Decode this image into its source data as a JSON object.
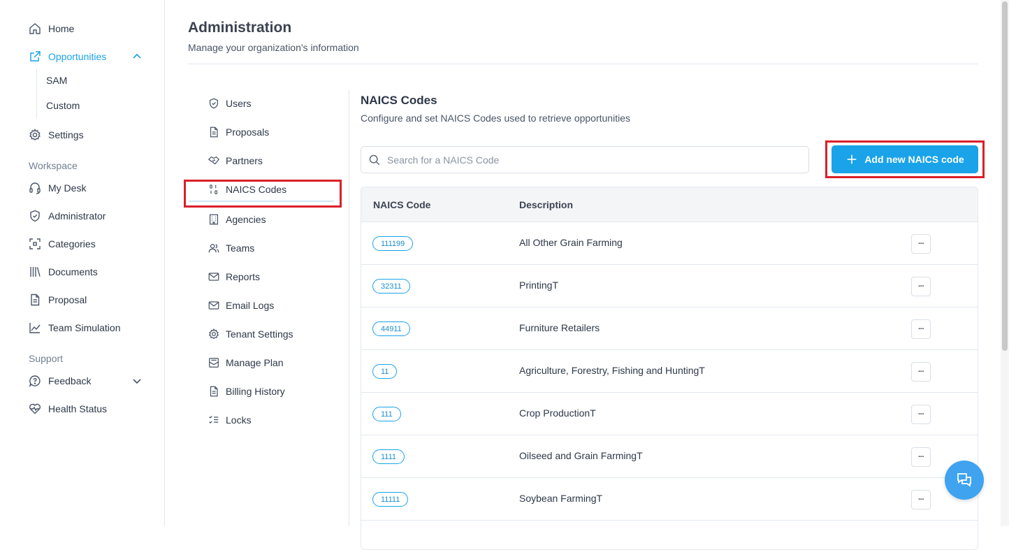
{
  "sidebar": {
    "home": "Home",
    "opportunities": "Opportunities",
    "opp_sub": [
      "SAM",
      "Custom"
    ],
    "settings": "Settings",
    "workspace_heading": "Workspace",
    "workspace": [
      "My Desk",
      "Administrator",
      "Categories",
      "Documents",
      "Proposal",
      "Team Simulation"
    ],
    "support_heading": "Support",
    "feedback": "Feedback",
    "health": "Health Status"
  },
  "header": {
    "title": "Administration",
    "subtitle": "Manage your organization's information"
  },
  "settings_menu": [
    "Users",
    "Proposals",
    "Partners",
    "NAICS Codes",
    "Agencies",
    "Teams",
    "Reports",
    "Email Logs",
    "Tenant Settings",
    "Manage Plan",
    "Billing History",
    "Locks"
  ],
  "content": {
    "title": "NAICS Codes",
    "subtitle": "Configure and set NAICS Codes used to retrieve opportunities",
    "search_placeholder": "Search for a NAICS Code",
    "add_label": "Add new NAICS code"
  },
  "table": {
    "headers": [
      "NAICS Code",
      "Description"
    ],
    "more_label": "···",
    "rows": [
      {
        "code": "111199",
        "description": "All Other Grain Farming"
      },
      {
        "code": "32311",
        "description": "PrintingT"
      },
      {
        "code": "44911",
        "description": "Furniture Retailers"
      },
      {
        "code": "11",
        "description": "Agriculture, Forestry, Fishing and HuntingT"
      },
      {
        "code": "111",
        "description": "Crop ProductionT"
      },
      {
        "code": "1111",
        "description": "Oilseed and Grain FarmingT"
      },
      {
        "code": "11111",
        "description": "Soybean FarmingT"
      }
    ]
  },
  "colors": {
    "accent": "#1aa3e8",
    "highlight_box": "#d9202a",
    "chat": "#3fa3f0"
  }
}
